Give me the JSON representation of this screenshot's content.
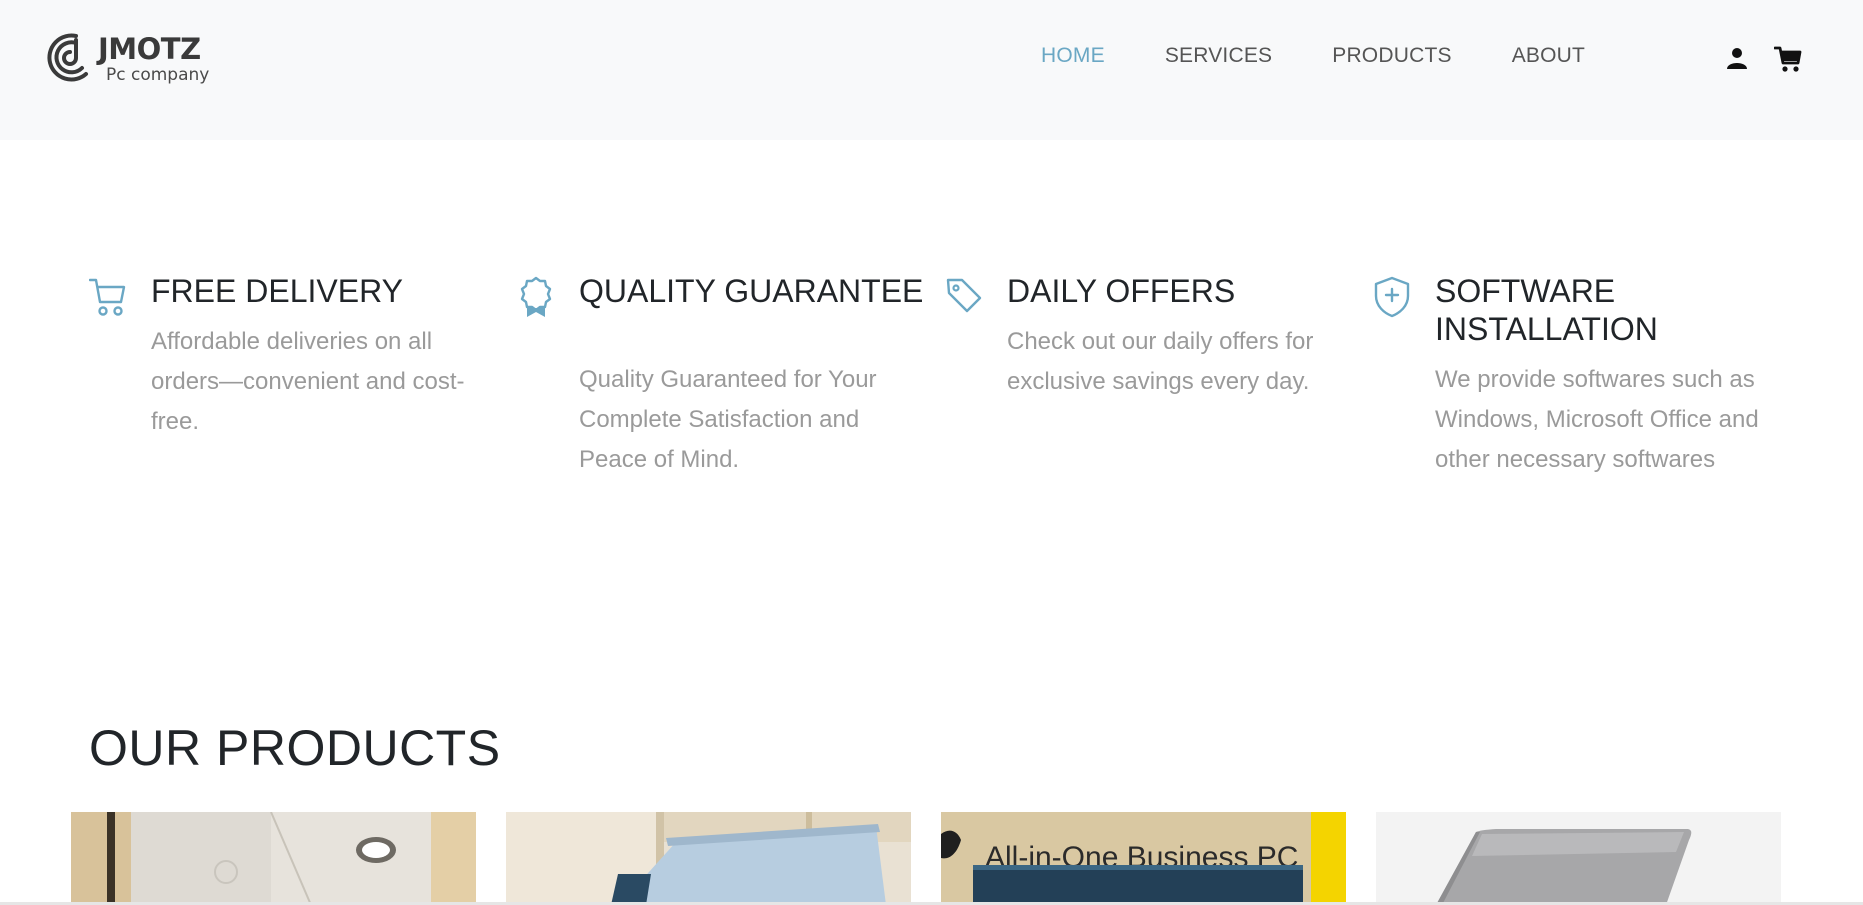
{
  "brand": {
    "name": "JMOTZ",
    "tagline": "Pc company"
  },
  "nav": {
    "items": [
      {
        "label": "HOME",
        "active": true
      },
      {
        "label": "SERVICES",
        "active": false
      },
      {
        "label": "PRODUCTS",
        "active": false
      },
      {
        "label": "ABOUT",
        "active": false
      }
    ],
    "icons": [
      "user-icon",
      "cart-icon"
    ]
  },
  "features": [
    {
      "icon": "cart-icon",
      "title": "FREE DELIVERY",
      "description": "Affordable deliveries on all orders—convenient and cost-free."
    },
    {
      "icon": "award-icon",
      "title": "QUALITY GUARANTEE",
      "description": "Quality Guaranteed for Your Complete Satisfaction and Peace of Mind."
    },
    {
      "icon": "tag-icon",
      "title": "DAILY OFFERS",
      "description": "Check out our daily offers for exclusive savings every day."
    },
    {
      "icon": "shield-plus-icon",
      "title": "SOFTWARE INSTALLATION",
      "description": "We provide softwares such as Windows, Microsoft Office and other necessary softwares"
    }
  ],
  "products_section": {
    "title": "OUR PRODUCTS",
    "cards": [
      {
        "image": "hp-laptop-box-photo"
      },
      {
        "image": "laptop-on-shelf-photo"
      },
      {
        "image": "hp-all-in-one-box-photo",
        "box_text": "All-in-One Business PC"
      },
      {
        "image": "silver-laptop-photo"
      }
    ]
  },
  "colors": {
    "accent": "#6aa7c4",
    "header_bg": "#f8f9fa",
    "muted_text": "#9a9a9a"
  }
}
